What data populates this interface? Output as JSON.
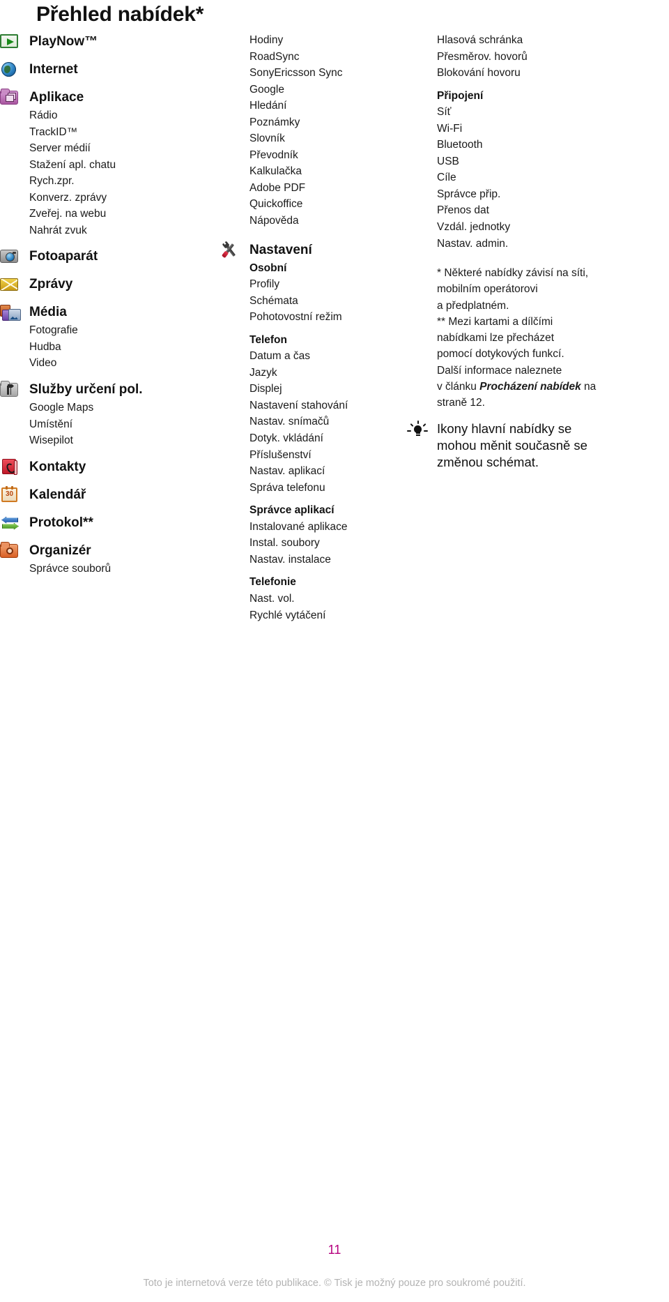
{
  "page": {
    "title": "Přehled nabídek*",
    "page_number": "11",
    "footer_note": "Toto je internetová verze této publikace. © Tisk je možný pouze pro soukromé použití.",
    "page_number_color": "#b5007e"
  },
  "column1": {
    "entries": [
      {
        "icon": "playnow-icon",
        "label": "PlayNow™",
        "sub": []
      },
      {
        "icon": "globe-icon",
        "label": "Internet",
        "sub": []
      },
      {
        "icon": "applications-folder-icon",
        "label": "Aplikace",
        "sub": [
          "Rádio",
          "TrackID™",
          "Server médií",
          "Stažení apl. chatu",
          "Rych.zpr.",
          "Konverz. zprávy",
          "Zveřej. na webu",
          "Nahrát zvuk"
        ]
      },
      {
        "icon": "camera-icon",
        "label": "Fotoaparát",
        "sub": []
      },
      {
        "icon": "envelope-icon",
        "label": "Zprávy",
        "sub": []
      },
      {
        "icon": "media-icon",
        "label": "Média",
        "sub": [
          "Fotografie",
          "Hudba",
          "Video"
        ]
      },
      {
        "icon": "location-folder-icon",
        "label": "Služby určení pol.",
        "sub": [
          "Google Maps",
          "Umístění",
          "Wisepilot"
        ]
      },
      {
        "icon": "contacts-book-icon",
        "label": "Kontakty",
        "sub": []
      },
      {
        "icon": "calendar-icon",
        "label": "Kalendář",
        "sub": []
      },
      {
        "icon": "call-log-arrows-icon",
        "label": "Protokol**",
        "sub": []
      },
      {
        "icon": "organizer-folder-icon",
        "label": "Organizér",
        "sub": [
          "Správce souborů"
        ]
      }
    ]
  },
  "column2": {
    "top_items": [
      "Hodiny",
      "RoadSync",
      "SonyEricsson Sync",
      "Google",
      "Hledání",
      "Poznámky",
      "Slovník",
      "Převodník",
      "Kalkulačka",
      "Adobe PDF",
      "Quickoffice",
      "Nápověda"
    ],
    "settings": {
      "icon": "tools-icon",
      "label": "Nastavení",
      "groups": [
        {
          "head": "Osobní",
          "items": [
            "Profily",
            "Schémata",
            "Pohotovostní režim"
          ]
        },
        {
          "head": "Telefon",
          "items": [
            "Datum a čas",
            "Jazyk",
            "Displej",
            "Nastavení stahování",
            "Nastav. snímačů",
            "Dotyk. vkládání",
            "Příslušenství",
            "Nastav. aplikací",
            "Správa telefonu"
          ]
        },
        {
          "head": "Správce aplikací",
          "items": [
            "Instalované aplikace",
            "Instal. soubory",
            "Nastav. instalace"
          ]
        },
        {
          "head": "Telefonie",
          "items": [
            "Nast. vol.",
            "Rychlé vytáčení"
          ]
        }
      ]
    }
  },
  "column3": {
    "top_items": [
      "Hlasová schránka",
      "Přesměrov. hovorů",
      "Blokování hovoru"
    ],
    "groups": [
      {
        "head": "Připojení",
        "items": [
          "Síť",
          "Wi-Fi",
          "Bluetooth",
          "USB",
          "Cíle",
          "Správce přip.",
          "Přenos dat",
          "Vzdál. jednotky",
          "Nastav. admin."
        ]
      }
    ],
    "footnote_lines": [
      "* Některé nabídky závisí na síti,",
      "mobilním operátorovi",
      "a předplatném.",
      "** Mezi kartami a dílčími",
      "nabídkami lze přecházet",
      "pomocí dotykových funkcí.",
      "Další informace naleznete"
    ],
    "footnote_last": {
      "prefix": "v článku ",
      "italic": "Procházení nabídek",
      "suffix": " na",
      "next_line": "straně 12."
    },
    "tip": {
      "icon": "lightbulb-icon",
      "lines": [
        "Ikony hlavní nabídky se",
        "mohou měnit současně se",
        "změnou schémat."
      ]
    }
  }
}
